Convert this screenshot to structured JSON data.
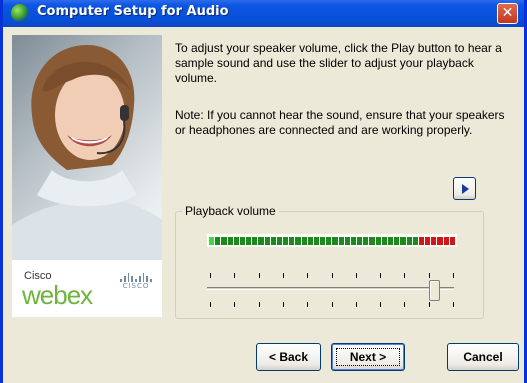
{
  "window": {
    "title": "Computer Setup for Audio",
    "close_glyph": "✕"
  },
  "branding": {
    "vendor_small": "Cisco",
    "product": "webex",
    "cisco_word": "CISCO"
  },
  "content": {
    "instructions": "To adjust your speaker volume, click the Play button to hear a sample sound and use the slider to adjust your playback volume.",
    "note": "Note: If you cannot hear the sound, ensure that your speakers or headphones are connected and are working properly."
  },
  "playback": {
    "group_label": "Playback volume",
    "slider_level": 0.92
  },
  "buttons": {
    "back": "< Back",
    "next": "Next >",
    "cancel": "Cancel"
  },
  "colors": {
    "title_bar": "#0A4FD6",
    "meter_green": "#1E8A1E",
    "meter_green_bright": "#3CDB3C",
    "meter_red": "#D01616",
    "webex_green": "#6FB43F"
  }
}
